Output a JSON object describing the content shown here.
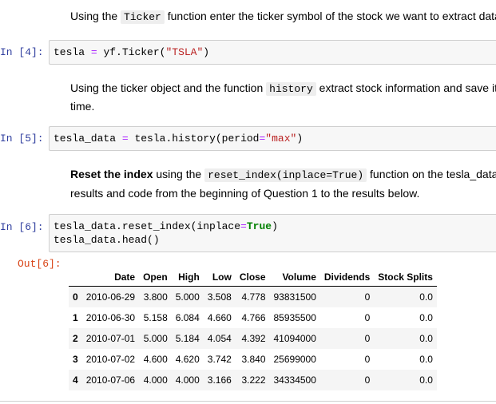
{
  "md1": {
    "before": "Using the ",
    "code": "Ticker",
    "after": " function enter the ticker symbol of the stock we want to extract data"
  },
  "cell4": {
    "prompt": "In [4]:",
    "code": {
      "var": "tesla",
      "eq": "=",
      "call": "yf.Ticker(",
      "arg": "\"TSLA\"",
      "close": ")"
    }
  },
  "md2": {
    "before": "Using the ticker object and the function ",
    "code": "history",
    "after": " extract stock information and save it",
    "line2": "time."
  },
  "cell5": {
    "prompt": "In [5]:",
    "code": {
      "var": "tesla_data",
      "eq": "=",
      "call": "tesla.history(period",
      "eq2": "=",
      "arg": "\"max\"",
      "close": ")"
    }
  },
  "md3": {
    "bold": "Reset the index",
    "before": " using the ",
    "code": "reset_index(inplace=True)",
    "after": " function on the tesla_data",
    "line2": "results and code from the beginning of Question 1 to the results below."
  },
  "cell6": {
    "prompt": "In [6]:",
    "line1": {
      "call": "tesla_data.reset_index(inplace",
      "eq": "=",
      "kw": "True",
      "close": ")"
    },
    "line2": "tesla_data.head()",
    "out_prompt": "Out[6]:"
  },
  "table": {
    "headers": [
      "",
      "Date",
      "Open",
      "High",
      "Low",
      "Close",
      "Volume",
      "Dividends",
      "Stock Splits"
    ],
    "rows": [
      [
        "0",
        "2010-06-29",
        "3.800",
        "5.000",
        "3.508",
        "4.778",
        "93831500",
        "0",
        "0.0"
      ],
      [
        "1",
        "2010-06-30",
        "5.158",
        "6.084",
        "4.660",
        "4.766",
        "85935500",
        "0",
        "0.0"
      ],
      [
        "2",
        "2010-07-01",
        "5.000",
        "5.184",
        "4.054",
        "4.392",
        "41094000",
        "0",
        "0.0"
      ],
      [
        "3",
        "2010-07-02",
        "4.600",
        "4.620",
        "3.742",
        "3.840",
        "25699000",
        "0",
        "0.0"
      ],
      [
        "4",
        "2010-07-06",
        "4.000",
        "4.000",
        "3.166",
        "3.222",
        "34334500",
        "0",
        "0.0"
      ]
    ]
  },
  "colors": {
    "in_prompt": "#303f9f",
    "out_prompt": "#d84315",
    "string": "#ba2121",
    "operator": "#aa22ff",
    "keyword": "#008000"
  }
}
